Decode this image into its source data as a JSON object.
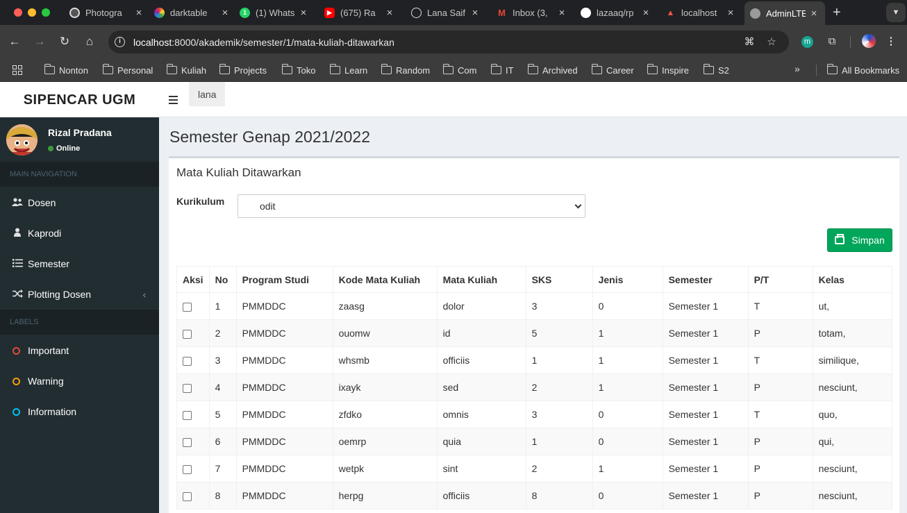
{
  "browser": {
    "tabs": [
      {
        "title": "Photogra",
        "icon": "aperture-icon"
      },
      {
        "title": "darktable",
        "icon": "darktable-icon"
      },
      {
        "title": "(1) Whats",
        "icon": "whatsapp-icon"
      },
      {
        "title": "(675) Ra",
        "icon": "youtube-icon"
      },
      {
        "title": "Lana Saif",
        "icon": "globe-icon"
      },
      {
        "title": "Inbox (3,",
        "icon": "gmail-icon"
      },
      {
        "title": "lazaaq/rp",
        "icon": "github-icon"
      },
      {
        "title": "localhost",
        "icon": "laravel-icon"
      },
      {
        "title": "AdminLTE",
        "icon": "globe-icon"
      }
    ],
    "url_host": "localhost",
    "url_path": ":8000/akademik/semester/1/mata-kuliah-ditawarkan",
    "extension_letter": "m",
    "bookmarks": [
      "Nonton",
      "Personal",
      "Kuliah",
      "Projects",
      "Toko",
      "Learn",
      "Random",
      "Com",
      "IT",
      "Archived",
      "Career",
      "Inspire",
      "S2"
    ],
    "all_bookmarks": "All Bookmarks"
  },
  "app": {
    "logo": "SIPENCAR UGM",
    "top_user": "lana",
    "user": {
      "name": "Rizal Pradana",
      "status": "Online"
    },
    "nav_header": "MAIN NAVIGATION",
    "nav": [
      {
        "label": "Dosen",
        "icon": "users-icon"
      },
      {
        "label": "Kaprodi",
        "icon": "user-icon"
      },
      {
        "label": "Semester",
        "icon": "list-icon"
      },
      {
        "label": "Plotting Dosen",
        "icon": "shuffle-icon"
      }
    ],
    "labels_header": "LABELS",
    "labels": [
      {
        "label": "Important",
        "color": "#dd4b39"
      },
      {
        "label": "Warning",
        "color": "#f39c12"
      },
      {
        "label": "Information",
        "color": "#00c0ef"
      }
    ]
  },
  "page": {
    "title": "Semester Genap 2021/2022",
    "box_title": "Mata Kuliah Ditawarkan",
    "kurikulum_label": "Kurikulum",
    "kurikulum_value": "odit",
    "save_label": "Simpan",
    "save_color": "#00a65a"
  },
  "table": {
    "columns": [
      "Aksi",
      "No",
      "Program Studi",
      "Kode Mata Kuliah",
      "Mata Kuliah",
      "SKS",
      "Jenis",
      "Semester",
      "P/T",
      "Kelas"
    ],
    "rows": [
      [
        "1",
        "PMMDDC",
        "zaasg",
        "dolor",
        "3",
        "0",
        "Semester 1",
        "T",
        "ut,"
      ],
      [
        "2",
        "PMMDDC",
        "ouomw",
        "id",
        "5",
        "1",
        "Semester 1",
        "P",
        "totam,"
      ],
      [
        "3",
        "PMMDDC",
        "whsmb",
        "officiis",
        "1",
        "1",
        "Semester 1",
        "T",
        "similique,"
      ],
      [
        "4",
        "PMMDDC",
        "ixayk",
        "sed",
        "2",
        "1",
        "Semester 1",
        "P",
        "nesciunt,"
      ],
      [
        "5",
        "PMMDDC",
        "zfdko",
        "omnis",
        "3",
        "0",
        "Semester 1",
        "T",
        "quo,"
      ],
      [
        "6",
        "PMMDDC",
        "oemrp",
        "quia",
        "1",
        "0",
        "Semester 1",
        "P",
        "qui,"
      ],
      [
        "7",
        "PMMDDC",
        "wetpk",
        "sint",
        "2",
        "1",
        "Semester 1",
        "P",
        "nesciunt,"
      ],
      [
        "8",
        "PMMDDC",
        "herpg",
        "officiis",
        "8",
        "0",
        "Semester 1",
        "P",
        "nesciunt,"
      ]
    ]
  }
}
